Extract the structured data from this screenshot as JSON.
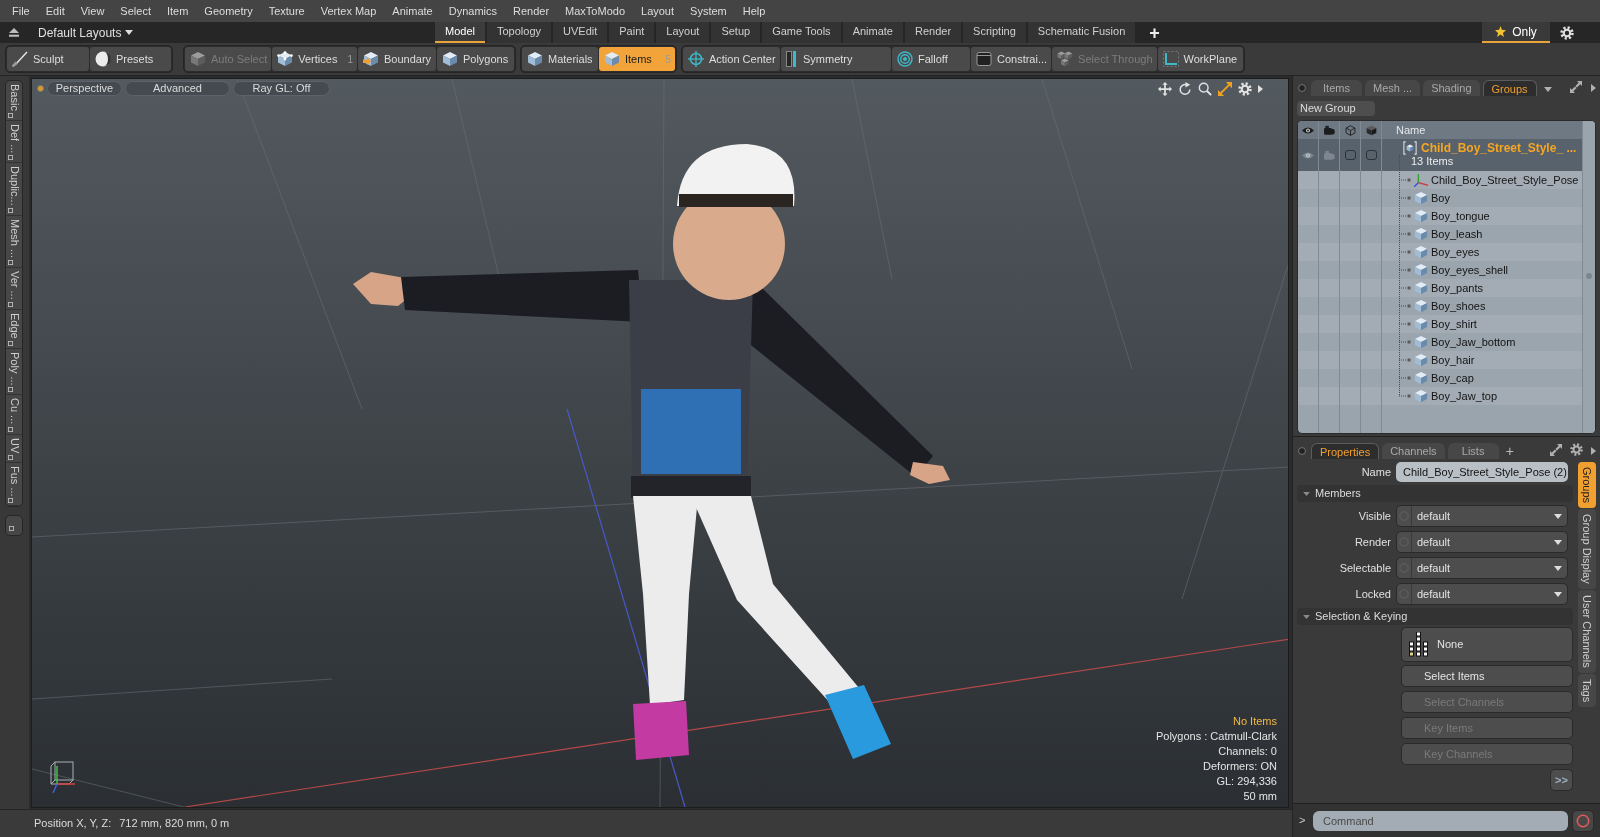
{
  "menu_bar": {
    "items": [
      "File",
      "Edit",
      "View",
      "Select",
      "Item",
      "Geometry",
      "Texture",
      "Vertex Map",
      "Animate",
      "Dynamics",
      "Render",
      "MaxToModo",
      "Layout",
      "System",
      "Help"
    ]
  },
  "layout_bar": {
    "layout_menu": "Default Layouts",
    "tabs": [
      {
        "label": "Model",
        "selected": true
      },
      {
        "label": "Topology",
        "selected": false
      },
      {
        "label": "UVEdit",
        "selected": false
      },
      {
        "label": "Paint",
        "selected": false
      },
      {
        "label": "Layout",
        "selected": false
      },
      {
        "label": "Setup",
        "selected": false
      },
      {
        "label": "Game Tools",
        "selected": false
      },
      {
        "label": "Animate",
        "selected": false
      },
      {
        "label": "Render",
        "selected": false
      },
      {
        "label": "Scripting",
        "selected": false
      },
      {
        "label": "Schematic Fusion",
        "selected": false
      }
    ],
    "add_tab": "+",
    "filter_toggle": {
      "label": "Only",
      "on": true
    }
  },
  "toolbar": {
    "groups": [
      {
        "buttons": [
          {
            "label": "Sculpt",
            "selected": false,
            "disabled": false
          },
          {
            "label": "Presets",
            "selected": false,
            "disabled": false
          }
        ]
      },
      {
        "buttons": [
          {
            "label": "Auto Select",
            "selected": false,
            "disabled": true
          },
          {
            "label": "Vertices",
            "count": "1",
            "selected": false,
            "disabled": false
          },
          {
            "label": "Boundary",
            "selected": false,
            "disabled": false
          },
          {
            "label": "Polygons",
            "selected": false,
            "disabled": false
          }
        ]
      },
      {
        "buttons": [
          {
            "label": "Materials",
            "selected": false,
            "disabled": false
          },
          {
            "label": "Items",
            "count": "5",
            "selected": true,
            "disabled": false
          }
        ]
      },
      {
        "buttons": [
          {
            "label": "Action Center",
            "selected": false,
            "disabled": false
          },
          {
            "label": "Symmetry",
            "selected": false,
            "disabled": false
          },
          {
            "label": "Falloff",
            "selected": false,
            "disabled": false
          },
          {
            "label": "Constrai...",
            "selected": false,
            "disabled": false
          },
          {
            "label": "Select Through",
            "selected": false,
            "disabled": true
          },
          {
            "label": "WorkPlane",
            "selected": false,
            "disabled": false
          }
        ]
      }
    ]
  },
  "left_tabs": {
    "tabs": [
      {
        "label": "Basic",
        "selected": false
      },
      {
        "label": "Def ...",
        "selected": false
      },
      {
        "label": "Duplic...",
        "selected": false
      },
      {
        "label": "Mesh ...",
        "selected": false
      },
      {
        "label": "Ver ...",
        "selected": false
      },
      {
        "label": "Edge",
        "selected": false
      },
      {
        "label": "Poly ...",
        "selected": false
      },
      {
        "label": "Cu ...",
        "selected": false
      },
      {
        "label": "UV",
        "selected": false
      },
      {
        "label": "Fus ...",
        "selected": false
      }
    ]
  },
  "viewport": {
    "view_buttons": [
      "Perspective",
      "Advanced",
      "Ray GL: Off"
    ],
    "info": [
      {
        "text": "No Items",
        "kind": "selection"
      },
      {
        "text": "Polygons : Catmull-Clark",
        "kind": "stat"
      },
      {
        "text": "Channels: 0",
        "kind": "stat"
      },
      {
        "text": "Deformers: ON",
        "kind": "stat"
      },
      {
        "text": "GL: 294,336",
        "kind": "stat"
      },
      {
        "text": "50 mm",
        "kind": "stat"
      }
    ]
  },
  "groups_panel": {
    "tabs": [
      {
        "label": "Items",
        "selected": false
      },
      {
        "label": "Mesh ...",
        "selected": false
      },
      {
        "label": "Shading",
        "selected": false
      },
      {
        "label": "Groups",
        "selected": true
      }
    ],
    "new_group_button": "New Group",
    "name_column": "Name",
    "group": {
      "name": "Child_Boy_Street_Style_ ...",
      "count": "13 Items",
      "selected": true,
      "children": [
        {
          "name": "Child_Boy_Street_Style_Pose",
          "kind": "locator"
        },
        {
          "name": "Boy",
          "kind": "mesh"
        },
        {
          "name": "Boy_tongue",
          "kind": "mesh"
        },
        {
          "name": "Boy_leash",
          "kind": "mesh"
        },
        {
          "name": "Boy_eyes",
          "kind": "mesh"
        },
        {
          "name": "Boy_eyes_shell",
          "kind": "mesh"
        },
        {
          "name": "Boy_pants",
          "kind": "mesh"
        },
        {
          "name": "Boy_shoes",
          "kind": "mesh"
        },
        {
          "name": "Boy_shirt",
          "kind": "mesh"
        },
        {
          "name": "Boy_Jaw_bottom",
          "kind": "mesh"
        },
        {
          "name": "Boy_hair",
          "kind": "mesh"
        },
        {
          "name": "Boy_cap",
          "kind": "mesh"
        },
        {
          "name": "Boy_Jaw_top",
          "kind": "mesh"
        }
      ]
    }
  },
  "properties_panel": {
    "tabs": [
      {
        "label": "Properties",
        "selected": true
      },
      {
        "label": "Channels",
        "selected": false
      },
      {
        "label": "Lists",
        "selected": false
      }
    ],
    "add_tab": "+",
    "name_field": {
      "label": "Name",
      "value": "Child_Boy_Street_Style_Pose (2)"
    },
    "sections": [
      {
        "title": "Members",
        "expanded": true,
        "dropdowns": [
          {
            "label": "Visible",
            "value": "default"
          },
          {
            "label": "Render",
            "value": "default"
          },
          {
            "label": "Selectable",
            "value": "default"
          },
          {
            "label": "Locked",
            "value": "default"
          }
        ]
      },
      {
        "title": "Selection & Keying",
        "expanded": true,
        "mode_button": "None",
        "actions": [
          {
            "label": "Select Items",
            "disabled": false
          },
          {
            "label": "Select Channels",
            "disabled": true
          },
          {
            "label": "Key Items",
            "disabled": true
          },
          {
            "label": "Key Channels",
            "disabled": true
          }
        ],
        "more_button": ">>"
      }
    ],
    "side_tabs": [
      {
        "label": "Groups",
        "selected": true
      },
      {
        "label": "Group Display",
        "selected": false
      },
      {
        "label": "User Channels",
        "selected": false
      },
      {
        "label": "Tags",
        "selected": false
      }
    ]
  },
  "command_bar": {
    "prompt": ">",
    "placeholder": "Command"
  },
  "status_bar": {
    "label": "Position X, Y, Z:",
    "value": "712 mm, 820 mm, 0 m"
  }
}
